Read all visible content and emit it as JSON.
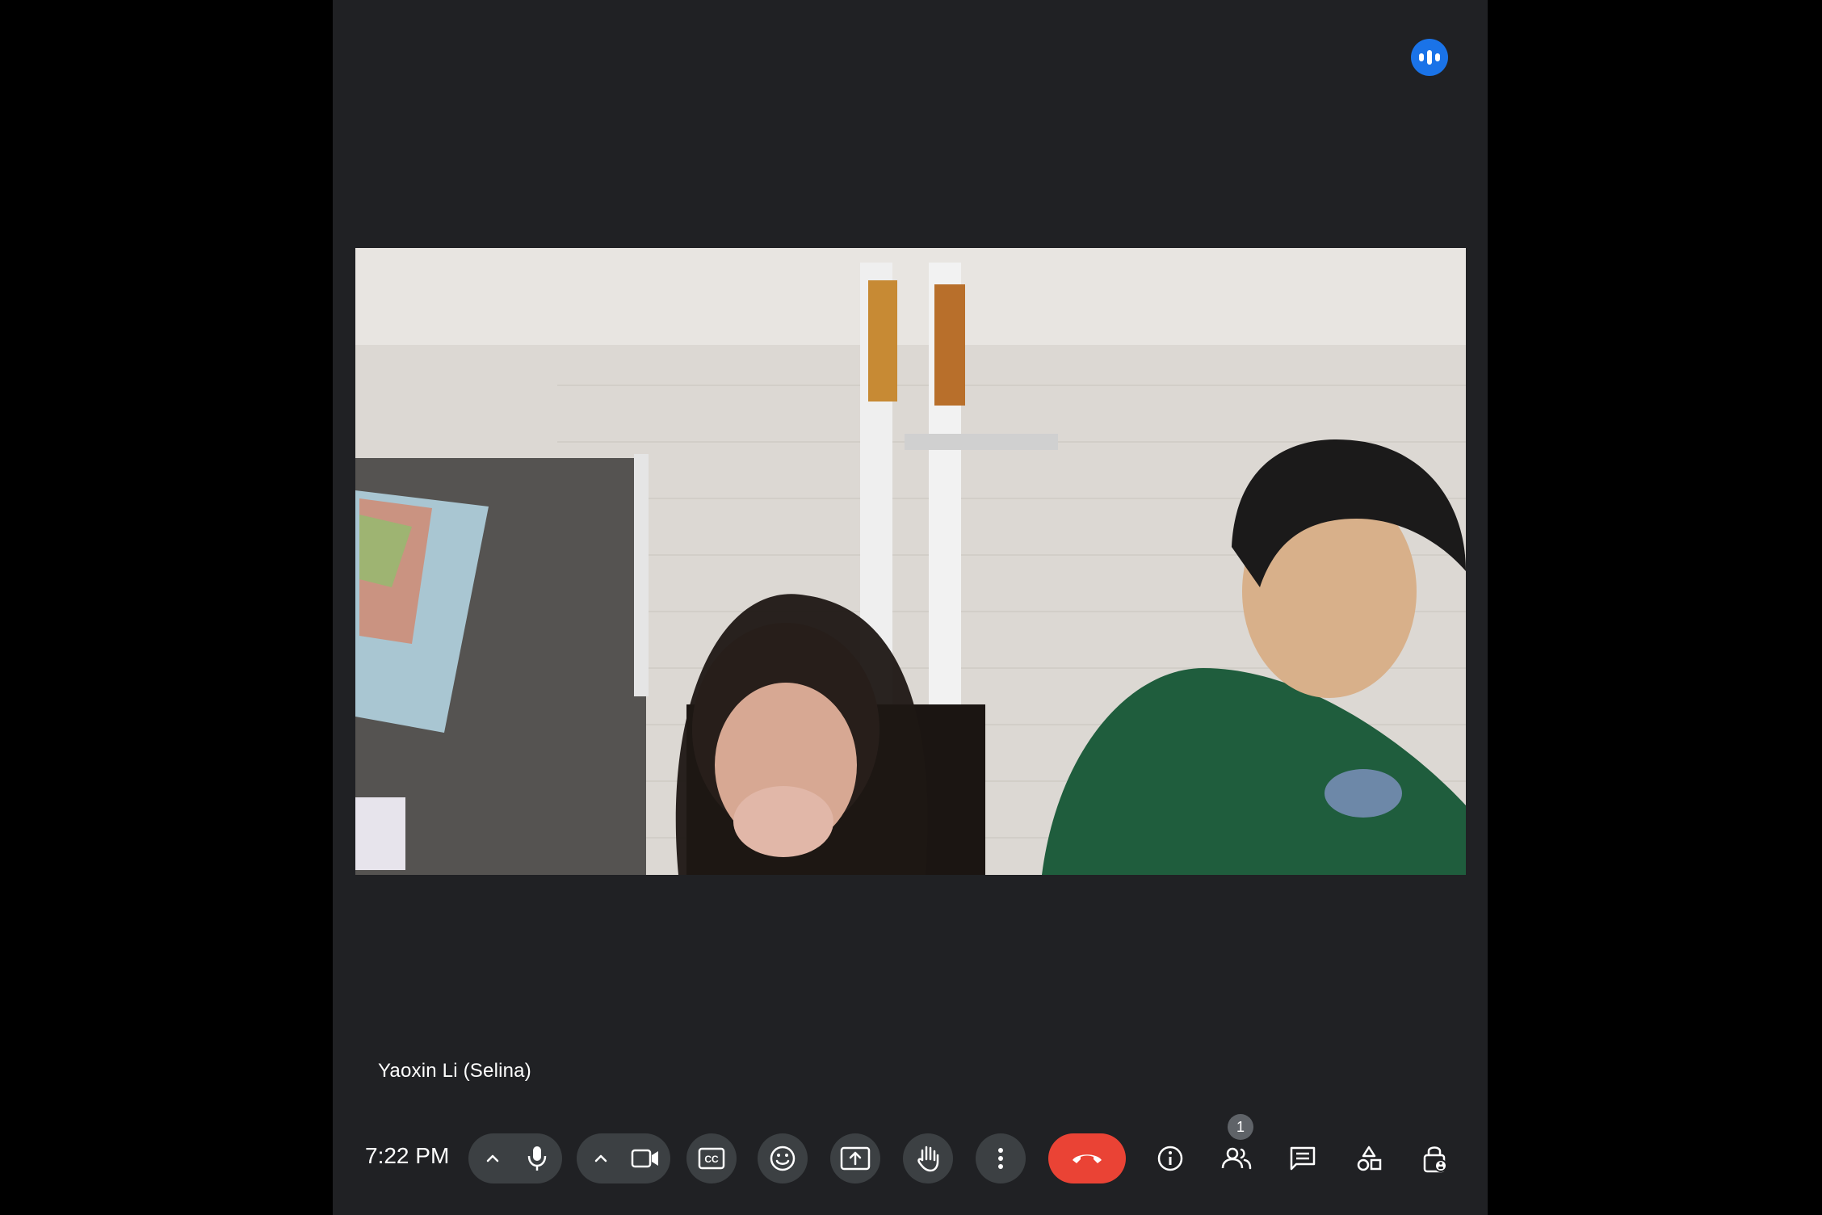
{
  "meeting": {
    "participant_name": "Yaoxin Li (Selina)",
    "time": "7:22 PM",
    "people_count": "1"
  },
  "icons": {
    "speaking": "audio-level-icon",
    "mic": "microphone-icon",
    "camera": "video-camera-icon",
    "captions": "closed-captions-icon",
    "reactions": "emoji-icon",
    "present": "present-screen-icon",
    "raise_hand": "raise-hand-icon",
    "more": "more-options-icon",
    "leave": "hang-up-icon",
    "info": "info-icon",
    "people": "people-icon",
    "chat": "chat-icon",
    "activities": "activities-icon",
    "host_controls": "host-controls-icon"
  },
  "colors": {
    "background": "#202124",
    "control": "#3c4043",
    "leave": "#ea4335",
    "speaking": "#1a73e8"
  }
}
